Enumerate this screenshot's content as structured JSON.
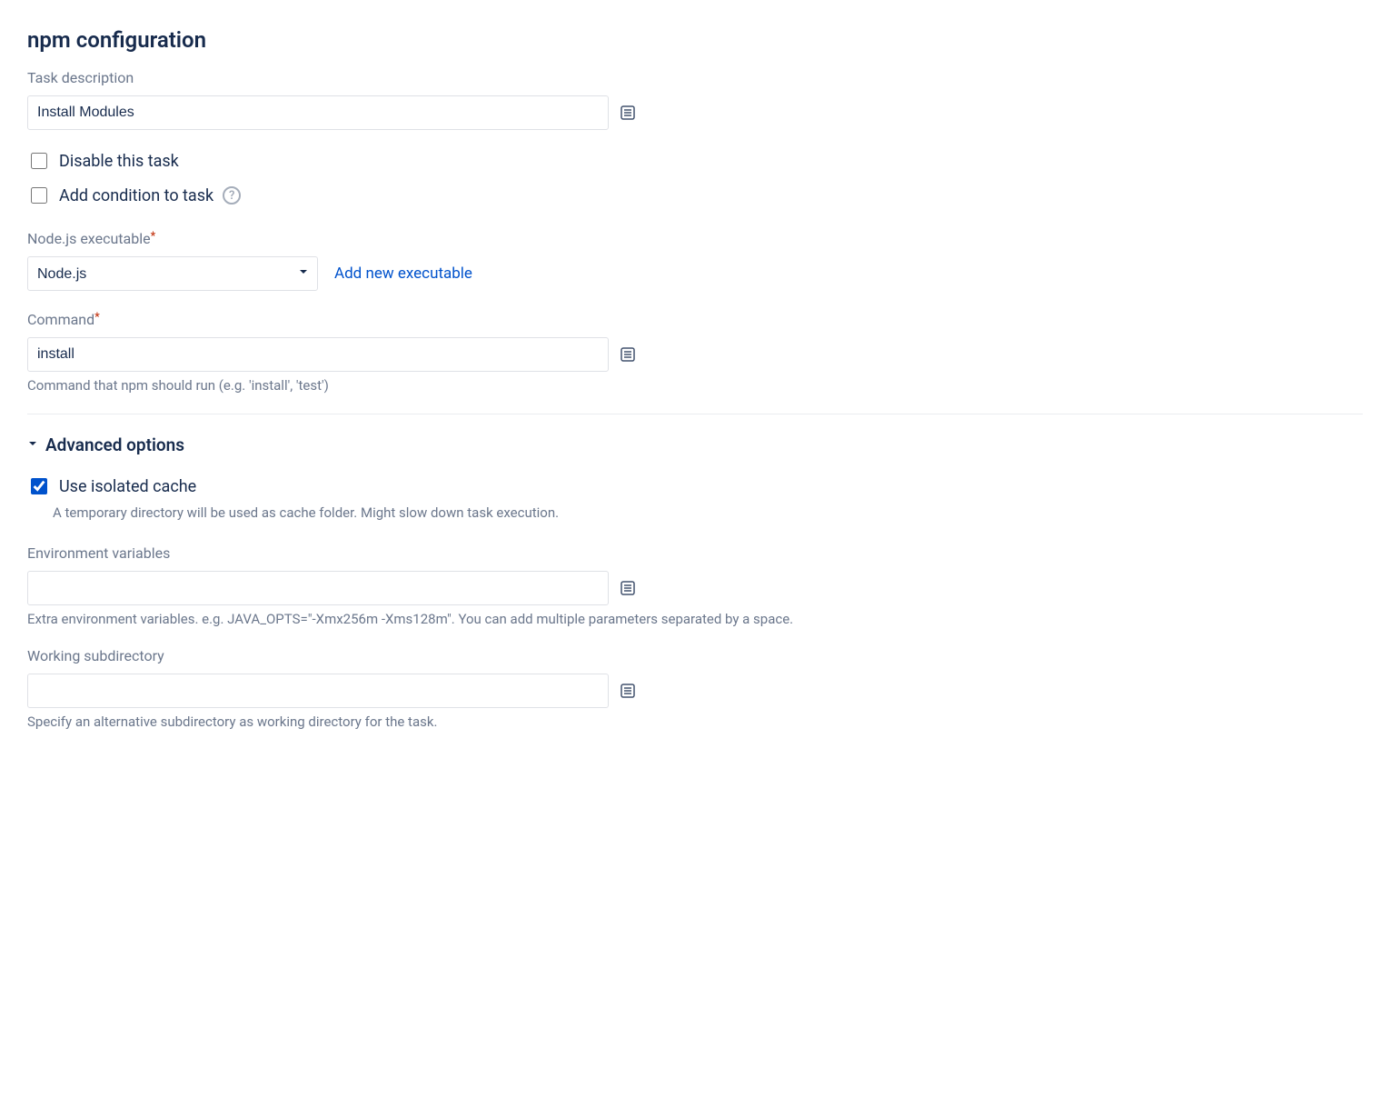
{
  "heading": "npm configuration",
  "taskDescription": {
    "label": "Task description",
    "value": "Install Modules"
  },
  "disableTask": {
    "label": "Disable this task",
    "checked": false
  },
  "addCondition": {
    "label": "Add condition to task",
    "checked": false
  },
  "nodeExecutable": {
    "label": "Node.js executable",
    "required": true,
    "selected": "Node.js",
    "addLink": "Add new executable"
  },
  "command": {
    "label": "Command",
    "required": true,
    "value": "install",
    "hint": "Command that npm should run (e.g. 'install', 'test')"
  },
  "advanced": {
    "title": "Advanced options",
    "isolatedCache": {
      "label": "Use isolated cache",
      "checked": true,
      "desc": "A temporary directory will be used as cache folder. Might slow down task execution."
    },
    "envVars": {
      "label": "Environment variables",
      "value": "",
      "hint": "Extra environment variables. e.g. JAVA_OPTS=\"-Xmx256m -Xms128m\". You can add multiple parameters separated by a space."
    },
    "workingSubdir": {
      "label": "Working subdirectory",
      "value": "",
      "hint": "Specify an alternative subdirectory as working directory for the task."
    }
  }
}
